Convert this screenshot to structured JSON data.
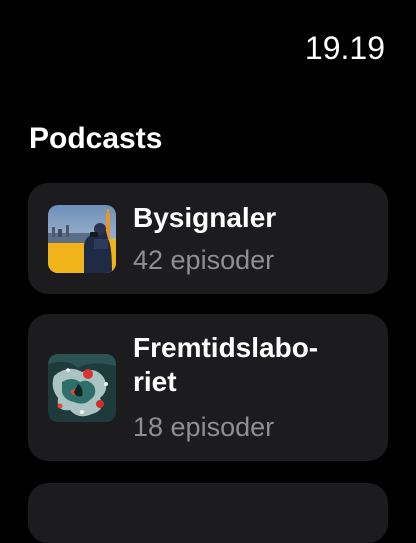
{
  "status": {
    "time": "19.19"
  },
  "header": {
    "title": "Podcasts"
  },
  "podcasts": [
    {
      "title": "Bysignaler",
      "episodes": "42 episoder",
      "artwork": "city-photographer-artwork"
    },
    {
      "title": "Fremtidslabo-\nriet",
      "episodes": "18 episoder",
      "artwork": "abstract-splatter-artwork"
    }
  ],
  "colors": {
    "background": "#000000",
    "card": "#1c1c1e",
    "primary_text": "#ffffff",
    "secondary_text": "#8e8e93"
  }
}
